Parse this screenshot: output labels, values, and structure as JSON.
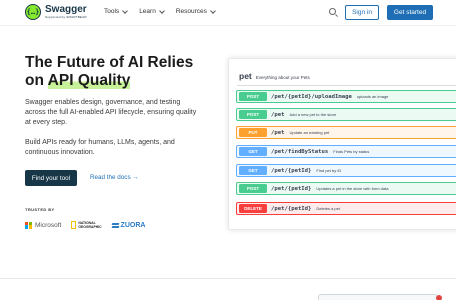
{
  "header": {
    "brand_name": "Swagger",
    "brand_sub": "Supported by SMARTBEAR",
    "nav": [
      {
        "label": "Tools"
      },
      {
        "label": "Learn"
      },
      {
        "label": "Resources"
      }
    ],
    "signin_label": "Sign in",
    "get_started_label": "Get started"
  },
  "hero": {
    "title_line1": "The Future of AI Relies",
    "title_line2_prefix": "on ",
    "title_line2_highlight": "API Quality",
    "paragraph1": "Swagger enables design, governance, and testing across the full AI-enabled API lifecycle, ensuring quality at every step.",
    "paragraph2": "Build APIs ready for humans, LLMs, agents, and continuous innovation.",
    "cta_primary": "Find your tool",
    "cta_secondary": "Read the docs →"
  },
  "trusted": {
    "label": "TRUSTED BY",
    "logos": [
      "Microsoft",
      "NATIONAL GEOGRAPHIC",
      "ZUORA"
    ],
    "natgeo_line1": "NATIONAL",
    "natgeo_line2": "GEOGRAPHIC"
  },
  "api_panel": {
    "tag": "pet",
    "tag_description": "Everything about your Pets",
    "operations": [
      {
        "method": "POST",
        "path": "/pet/{petId}/uploadImage",
        "description": "uploads an image"
      },
      {
        "method": "POST",
        "path": "/pet",
        "description": "Add a new pet to the store"
      },
      {
        "method": "PUT",
        "path": "/pet",
        "description": "Update an existing pet"
      },
      {
        "method": "GET",
        "path": "/pet/findByStatus",
        "description": "Finds Pets by status"
      },
      {
        "method": "GET",
        "path": "/pet/{petId}",
        "description": "Find pet by ID"
      },
      {
        "method": "POST",
        "path": "/pet/{petId}",
        "description": "Updates a pet in the store with form data"
      },
      {
        "method": "DELETE",
        "path": "/pet/{petId}",
        "description": "Deletes a pet"
      }
    ]
  },
  "colors": {
    "brand_green": "#85ea2d",
    "brand_navy": "#173647",
    "primary_blue": "#1e6eb5",
    "post": "#49cc90",
    "put": "#fca130",
    "get": "#61affe",
    "delete": "#f93e3e"
  },
  "icons": [
    "swagger-logo-icon",
    "chevron-down-icon",
    "search-icon",
    "microsoft-logo-icon",
    "natgeo-logo-icon",
    "zuora-logo-icon"
  ]
}
